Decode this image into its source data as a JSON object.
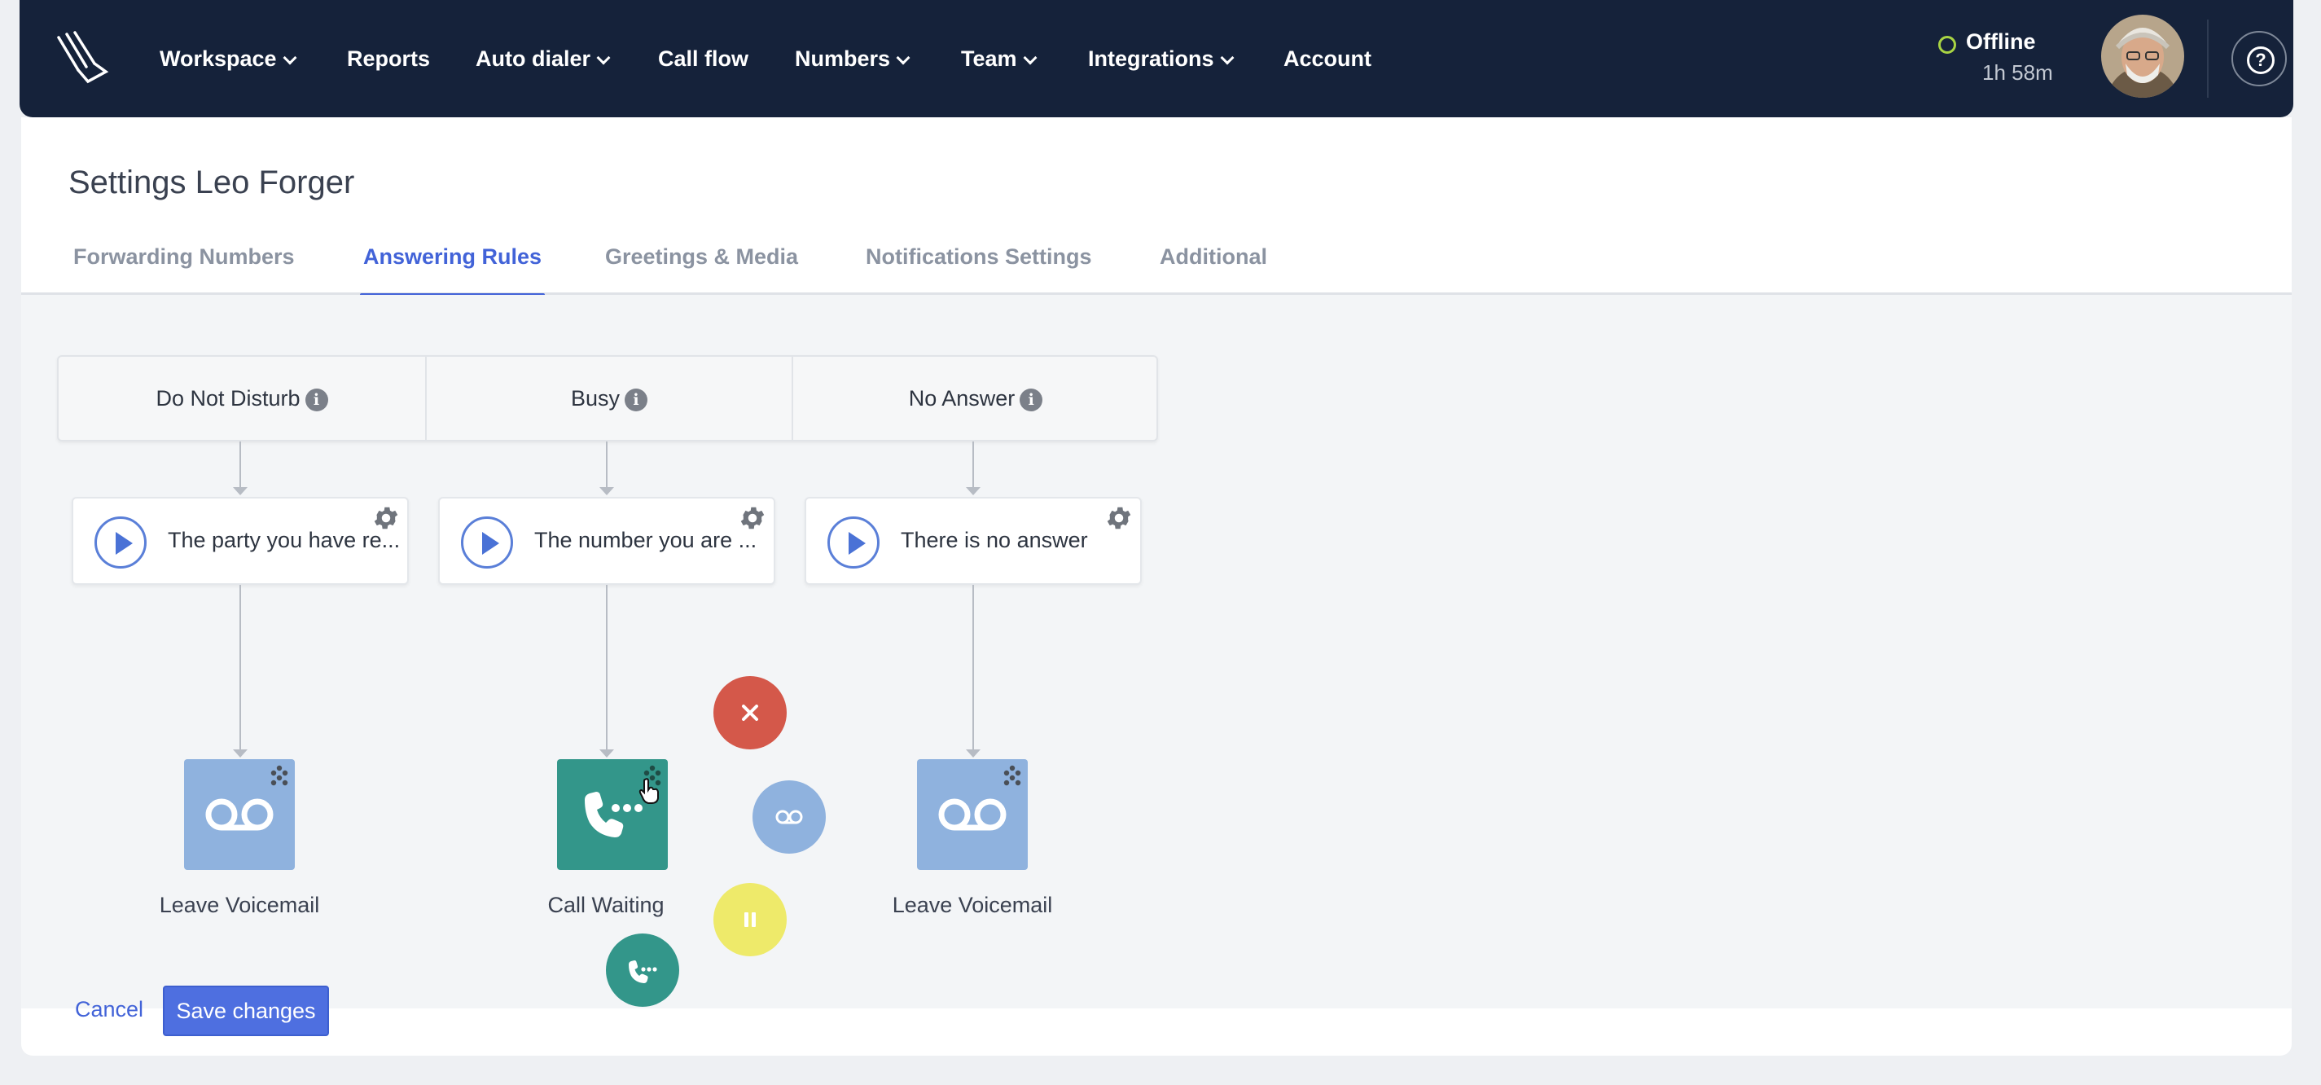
{
  "nav": {
    "items": [
      {
        "label": "Workspace",
        "dropdown": true
      },
      {
        "label": "Reports",
        "dropdown": false
      },
      {
        "label": "Auto dialer",
        "dropdown": true
      },
      {
        "label": "Call flow",
        "dropdown": false
      },
      {
        "label": "Numbers",
        "dropdown": true
      },
      {
        "label": "Team",
        "dropdown": true
      },
      {
        "label": "Integrations",
        "dropdown": true
      },
      {
        "label": "Account",
        "dropdown": false
      }
    ],
    "status": {
      "label": "Offline",
      "time": "1h 58m",
      "color": "#a8d443"
    },
    "help_glyph": "?"
  },
  "page": {
    "title": "Settings Leo Forger"
  },
  "tabs": [
    {
      "label": "Forwarding Numbers",
      "active": false
    },
    {
      "label": "Answering Rules",
      "active": true
    },
    {
      "label": "Greetings & Media",
      "active": false
    },
    {
      "label": "Notifications Settings",
      "active": false
    },
    {
      "label": "Additional",
      "active": false
    }
  ],
  "rules": [
    {
      "header": "Do Not Disturb",
      "greeting": "The party you have re...",
      "action": "Leave Voicemail",
      "action_icon": "voicemail-icon"
    },
    {
      "header": "Busy",
      "greeting": "The number you are ...",
      "action": "Call Waiting",
      "action_icon": "call-waiting-icon"
    },
    {
      "header": "No Answer",
      "greeting": "There is no answer",
      "action": "Leave Voicemail",
      "action_icon": "voicemail-icon"
    }
  ],
  "info_glyph": "i",
  "picker": {
    "options": [
      "close-icon",
      "voicemail-icon",
      "hold-icon",
      "call-waiting-icon"
    ],
    "colors": {
      "close": "#d4584a",
      "voicemail": "#8fb2de",
      "hold": "#eeea6a",
      "call_waiting": "#33968a"
    }
  },
  "footer": {
    "cancel": "Cancel",
    "save": "Save changes"
  },
  "colors": {
    "nav_bg": "#15223a",
    "accent": "#4263d8",
    "save_bg": "#4e6fe0"
  }
}
